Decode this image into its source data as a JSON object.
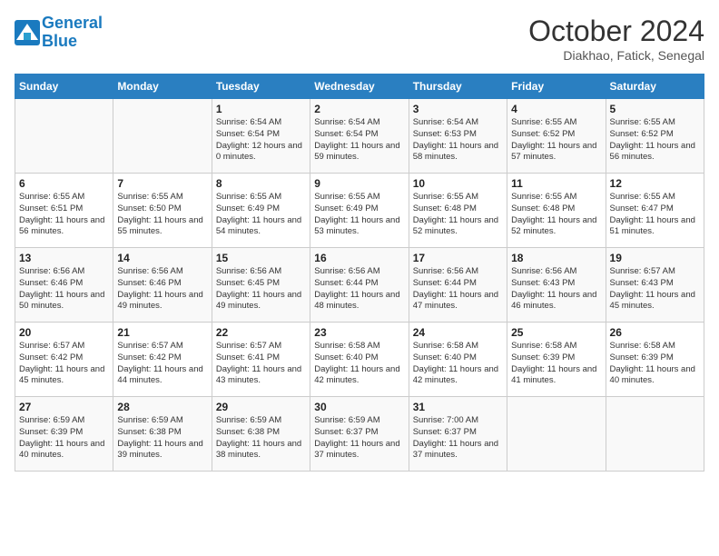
{
  "header": {
    "logo_line1": "General",
    "logo_line2": "Blue",
    "month": "October 2024",
    "location": "Diakhao, Fatick, Senegal"
  },
  "weekdays": [
    "Sunday",
    "Monday",
    "Tuesday",
    "Wednesday",
    "Thursday",
    "Friday",
    "Saturday"
  ],
  "weeks": [
    [
      {
        "day": "",
        "info": ""
      },
      {
        "day": "",
        "info": ""
      },
      {
        "day": "1",
        "info": "Sunrise: 6:54 AM\nSunset: 6:54 PM\nDaylight: 12 hours\nand 0 minutes."
      },
      {
        "day": "2",
        "info": "Sunrise: 6:54 AM\nSunset: 6:54 PM\nDaylight: 11 hours\nand 59 minutes."
      },
      {
        "day": "3",
        "info": "Sunrise: 6:54 AM\nSunset: 6:53 PM\nDaylight: 11 hours\nand 58 minutes."
      },
      {
        "day": "4",
        "info": "Sunrise: 6:55 AM\nSunset: 6:52 PM\nDaylight: 11 hours\nand 57 minutes."
      },
      {
        "day": "5",
        "info": "Sunrise: 6:55 AM\nSunset: 6:52 PM\nDaylight: 11 hours\nand 56 minutes."
      }
    ],
    [
      {
        "day": "6",
        "info": "Sunrise: 6:55 AM\nSunset: 6:51 PM\nDaylight: 11 hours\nand 56 minutes."
      },
      {
        "day": "7",
        "info": "Sunrise: 6:55 AM\nSunset: 6:50 PM\nDaylight: 11 hours\nand 55 minutes."
      },
      {
        "day": "8",
        "info": "Sunrise: 6:55 AM\nSunset: 6:49 PM\nDaylight: 11 hours\nand 54 minutes."
      },
      {
        "day": "9",
        "info": "Sunrise: 6:55 AM\nSunset: 6:49 PM\nDaylight: 11 hours\nand 53 minutes."
      },
      {
        "day": "10",
        "info": "Sunrise: 6:55 AM\nSunset: 6:48 PM\nDaylight: 11 hours\nand 52 minutes."
      },
      {
        "day": "11",
        "info": "Sunrise: 6:55 AM\nSunset: 6:48 PM\nDaylight: 11 hours\nand 52 minutes."
      },
      {
        "day": "12",
        "info": "Sunrise: 6:55 AM\nSunset: 6:47 PM\nDaylight: 11 hours\nand 51 minutes."
      }
    ],
    [
      {
        "day": "13",
        "info": "Sunrise: 6:56 AM\nSunset: 6:46 PM\nDaylight: 11 hours\nand 50 minutes."
      },
      {
        "day": "14",
        "info": "Sunrise: 6:56 AM\nSunset: 6:46 PM\nDaylight: 11 hours\nand 49 minutes."
      },
      {
        "day": "15",
        "info": "Sunrise: 6:56 AM\nSunset: 6:45 PM\nDaylight: 11 hours\nand 49 minutes."
      },
      {
        "day": "16",
        "info": "Sunrise: 6:56 AM\nSunset: 6:44 PM\nDaylight: 11 hours\nand 48 minutes."
      },
      {
        "day": "17",
        "info": "Sunrise: 6:56 AM\nSunset: 6:44 PM\nDaylight: 11 hours\nand 47 minutes."
      },
      {
        "day": "18",
        "info": "Sunrise: 6:56 AM\nSunset: 6:43 PM\nDaylight: 11 hours\nand 46 minutes."
      },
      {
        "day": "19",
        "info": "Sunrise: 6:57 AM\nSunset: 6:43 PM\nDaylight: 11 hours\nand 45 minutes."
      }
    ],
    [
      {
        "day": "20",
        "info": "Sunrise: 6:57 AM\nSunset: 6:42 PM\nDaylight: 11 hours\nand 45 minutes."
      },
      {
        "day": "21",
        "info": "Sunrise: 6:57 AM\nSunset: 6:42 PM\nDaylight: 11 hours\nand 44 minutes."
      },
      {
        "day": "22",
        "info": "Sunrise: 6:57 AM\nSunset: 6:41 PM\nDaylight: 11 hours\nand 43 minutes."
      },
      {
        "day": "23",
        "info": "Sunrise: 6:58 AM\nSunset: 6:40 PM\nDaylight: 11 hours\nand 42 minutes."
      },
      {
        "day": "24",
        "info": "Sunrise: 6:58 AM\nSunset: 6:40 PM\nDaylight: 11 hours\nand 42 minutes."
      },
      {
        "day": "25",
        "info": "Sunrise: 6:58 AM\nSunset: 6:39 PM\nDaylight: 11 hours\nand 41 minutes."
      },
      {
        "day": "26",
        "info": "Sunrise: 6:58 AM\nSunset: 6:39 PM\nDaylight: 11 hours\nand 40 minutes."
      }
    ],
    [
      {
        "day": "27",
        "info": "Sunrise: 6:59 AM\nSunset: 6:39 PM\nDaylight: 11 hours\nand 40 minutes."
      },
      {
        "day": "28",
        "info": "Sunrise: 6:59 AM\nSunset: 6:38 PM\nDaylight: 11 hours\nand 39 minutes."
      },
      {
        "day": "29",
        "info": "Sunrise: 6:59 AM\nSunset: 6:38 PM\nDaylight: 11 hours\nand 38 minutes."
      },
      {
        "day": "30",
        "info": "Sunrise: 6:59 AM\nSunset: 6:37 PM\nDaylight: 11 hours\nand 37 minutes."
      },
      {
        "day": "31",
        "info": "Sunrise: 7:00 AM\nSunset: 6:37 PM\nDaylight: 11 hours\nand 37 minutes."
      },
      {
        "day": "",
        "info": ""
      },
      {
        "day": "",
        "info": ""
      }
    ]
  ]
}
